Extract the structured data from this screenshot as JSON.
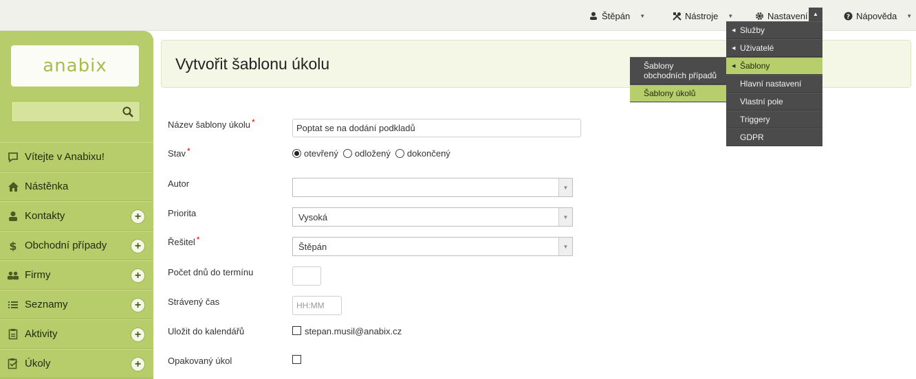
{
  "topbar": {
    "user_label": "Štěpán",
    "tools_label": "Nástroje",
    "settings_label": "Nastavení",
    "help_label": "Nápověda"
  },
  "sidebar": {
    "logo_text": "anabix",
    "search_placeholder": "",
    "items": [
      {
        "label": "Vítejte v Anabixu!",
        "icon": "chat-icon",
        "has_plus": false
      },
      {
        "label": "Nástěnka",
        "icon": "home-icon",
        "has_plus": false
      },
      {
        "label": "Kontakty",
        "icon": "person-icon",
        "has_plus": true
      },
      {
        "label": "Obchodní případy",
        "icon": "dollar-icon",
        "has_plus": true
      },
      {
        "label": "Firmy",
        "icon": "group-icon",
        "has_plus": true
      },
      {
        "label": "Seznamy",
        "icon": "list-icon",
        "has_plus": true
      },
      {
        "label": "Aktivity",
        "icon": "clipboard-icon",
        "has_plus": true
      },
      {
        "label": "Úkoly",
        "icon": "task-icon",
        "has_plus": true
      }
    ]
  },
  "page": {
    "title": "Vytvořit šablonu úkolu"
  },
  "form": {
    "name_label": "Název šablony úkolu",
    "name_value": "Poptat se na dodání podkladů",
    "status_label": "Stav",
    "status_options": [
      "otevřený",
      "odložený",
      "dokončený"
    ],
    "status_selected": "otevřený",
    "author_label": "Autor",
    "author_value": "",
    "priority_label": "Priorita",
    "priority_value": "Vysoká",
    "solver_label": "Řešitel",
    "solver_value": "Štěpán",
    "days_label": "Počet dnů do termínu",
    "days_value": "",
    "time_label": "Strávený čas",
    "time_placeholder": "HH:MM",
    "calendar_label": "Uložit do kalendářů",
    "calendar_email": "stepan.musil@anabix.cz",
    "repeat_label": "Opakovaný úkol",
    "required_mark": "*"
  },
  "settings_menu": {
    "items": [
      "Služby",
      "Uživatelé",
      "Šablony",
      "Hlavní nastavení",
      "Vlastní pole",
      "Triggery",
      "GDPR"
    ],
    "active": "Šablony",
    "submenu": {
      "item1_line1": "Šablony",
      "item1_line2": "obchodních případů",
      "item2": "Šablony úkolů",
      "active": "Šablony úkolů"
    }
  },
  "colors": {
    "brand_green": "#b7cc6a",
    "menu_dark": "#4b4b4b",
    "required_red": "#dd0000"
  }
}
